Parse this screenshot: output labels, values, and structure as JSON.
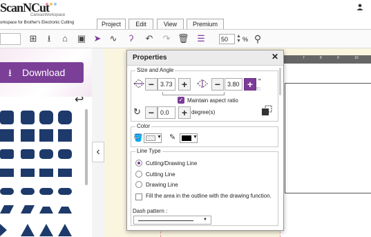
{
  "app": {
    "logo_text": "ScanNCut",
    "logo_sub": "CanvasWorkspace",
    "subtitle": "orkspace for Brother's Electronic Cutting"
  },
  "tabs": [
    {
      "label": "Project"
    },
    {
      "label": "Edit"
    },
    {
      "label": "View"
    },
    {
      "label": "Premium"
    }
  ],
  "toolbar": {
    "zoom_value": "50",
    "zoom_unit": "%",
    "icons": [
      "add-shape-icon",
      "import-icon",
      "export-icon",
      "scan-icon",
      "select-arrow-icon",
      "pen-icon",
      "curve-tool-icon",
      "undo-icon",
      "redo-icon",
      "trash-icon",
      "layers-icon",
      "search-icon"
    ]
  },
  "download": {
    "label": "Download"
  },
  "ruler": {
    "marks": [
      "7",
      "8",
      "9",
      "10"
    ]
  },
  "properties": {
    "title": "Properties",
    "close": "✕",
    "size_angle": {
      "label": "Size and Angle",
      "width": "3.73",
      "height": "3.80",
      "unit": "\"",
      "maintain_aspect": "Maintain aspect ratio",
      "maintain_checked": true,
      "angle": "0.0",
      "angle_unit": "degree(s)"
    },
    "color": {
      "label": "Color"
    },
    "line_type": {
      "label": "Line Type",
      "options": [
        {
          "label": "Cutting/Drawing Line",
          "selected": true
        },
        {
          "label": "Cutting Line",
          "selected": false
        },
        {
          "label": "Drawing Line",
          "selected": false
        }
      ],
      "fill_label": "Fill the area in the outline with the drawing function.",
      "dash_label": "Dash pattern :"
    }
  },
  "colors": {
    "accent": "#7d3c98",
    "download_bg": "#7b3f97",
    "shape_fill": "#1d3a6b"
  }
}
